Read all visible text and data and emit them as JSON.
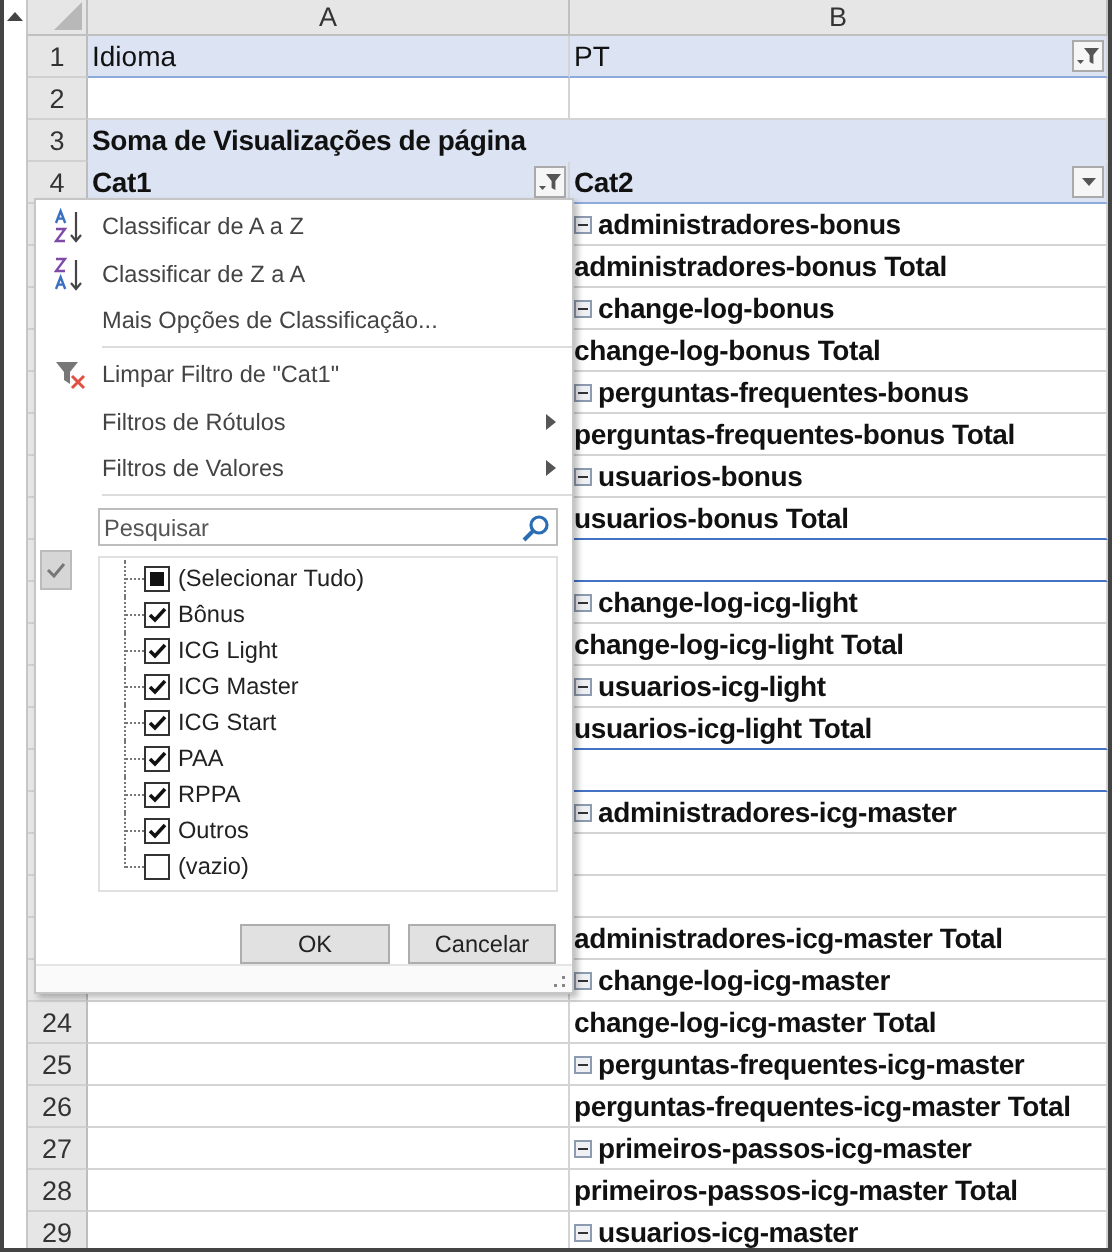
{
  "columns": [
    "A",
    "B"
  ],
  "rows": [
    {
      "number": "1",
      "kind": "field",
      "a": "Idioma",
      "b": "PT",
      "b_button": {
        "filtered": true
      }
    },
    {
      "number": "2",
      "kind": "blank"
    },
    {
      "number": "3",
      "kind": "title",
      "a": "Soma de Visualizações de página"
    },
    {
      "number": "4",
      "kind": "header",
      "a": "Cat1",
      "a_button": {
        "filtered": true
      },
      "b": "Cat2",
      "b_button": {
        "filtered": false
      }
    },
    {
      "kind": "item",
      "b": "administradores-bonus"
    },
    {
      "kind": "total",
      "b": "administradores-bonus Total"
    },
    {
      "kind": "item",
      "b": "change-log-bonus"
    },
    {
      "kind": "total",
      "b": "change-log-bonus Total"
    },
    {
      "kind": "item",
      "b": "perguntas-frequentes-bonus"
    },
    {
      "kind": "total",
      "b": "perguntas-frequentes-bonus Total"
    },
    {
      "kind": "item",
      "b": "usuarios-bonus"
    },
    {
      "kind": "total",
      "b": "usuarios-bonus Total",
      "end": true
    },
    {
      "kind": "blank",
      "end": true
    },
    {
      "kind": "item",
      "b": "change-log-icg-light"
    },
    {
      "kind": "total",
      "b": "change-log-icg-light Total"
    },
    {
      "kind": "item",
      "b": "usuarios-icg-light"
    },
    {
      "kind": "total",
      "b": "usuarios-icg-light Total",
      "end": true
    },
    {
      "kind": "blank",
      "end": true
    },
    {
      "kind": "item",
      "b": "administradores-icg-master"
    },
    {
      "kind": "blank"
    },
    {
      "kind": "blank"
    },
    {
      "kind": "total",
      "b": "administradores-icg-master Total"
    },
    {
      "kind": "item",
      "b": "change-log-icg-master"
    },
    {
      "number": "24",
      "kind": "total",
      "b": "change-log-icg-master Total"
    },
    {
      "number": "25",
      "kind": "item",
      "b": "perguntas-frequentes-icg-master"
    },
    {
      "number": "26",
      "kind": "total",
      "b": "perguntas-frequentes-icg-master Total"
    },
    {
      "number": "27",
      "kind": "item",
      "b": "primeiros-passos-icg-master"
    },
    {
      "number": "28",
      "kind": "total",
      "b": "primeiros-passos-icg-master Total"
    },
    {
      "number": "29",
      "kind": "item",
      "b": "usuarios-icg-master"
    }
  ],
  "filter_menu": {
    "items": [
      {
        "kind": "sort-az",
        "label": "Classificar de A a Z"
      },
      {
        "kind": "sort-za",
        "label": "Classificar de Z a A"
      },
      {
        "kind": "plain",
        "label": "Mais Opções de Classificação..."
      },
      {
        "kind": "separator"
      },
      {
        "kind": "clear",
        "label": "Limpar Filtro de \"Cat1\""
      },
      {
        "kind": "submenu",
        "label": "Filtros de Rótulos"
      },
      {
        "kind": "submenu",
        "label": "Filtros de Valores"
      }
    ],
    "search": {
      "placeholder": "Pesquisar"
    },
    "select_toggle": {
      "on": true
    },
    "values": [
      {
        "label": "(Selecionar Tudo)",
        "checked": true,
        "partial": true
      },
      {
        "label": "Bônus",
        "checked": true
      },
      {
        "label": "ICG Light",
        "checked": true
      },
      {
        "label": "ICG Master",
        "checked": true
      },
      {
        "label": "ICG Start",
        "checked": true
      },
      {
        "label": "PAA",
        "checked": true
      },
      {
        "label": "RPPA",
        "checked": true
      },
      {
        "label": "Outros",
        "checked": true
      },
      {
        "label": "(vazio)",
        "checked": false
      }
    ],
    "buttons": [
      "OK",
      "Cancelar"
    ]
  }
}
